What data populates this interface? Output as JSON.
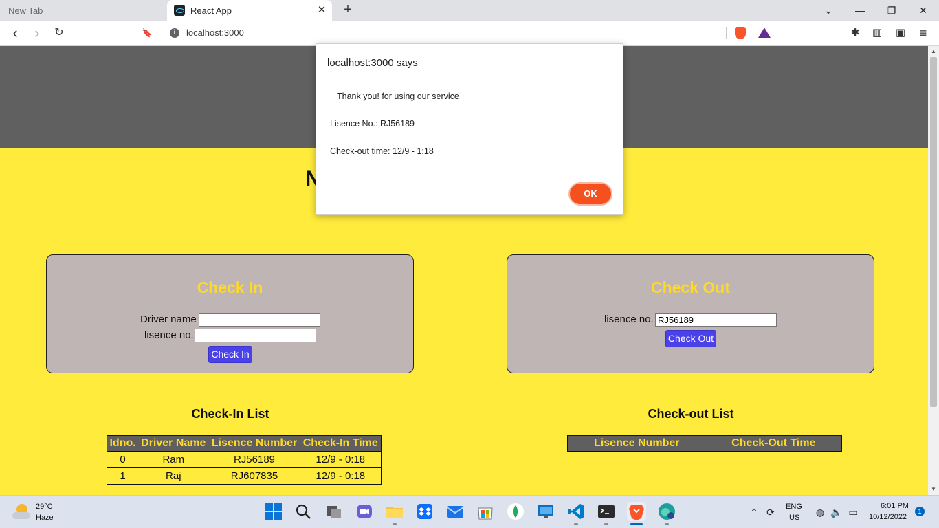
{
  "browser": {
    "tabs": [
      {
        "title": "New Tab",
        "active": false
      },
      {
        "title": "React App",
        "active": true
      }
    ],
    "url": "localhost:3000",
    "icons": {
      "back": "‹",
      "forward": "›",
      "reload": "↻",
      "bookmark": "🔖",
      "close": "✕",
      "new_tab": "+",
      "tab_search": "⌄",
      "minimize": "—",
      "restore": "❐",
      "close_window": "✕",
      "extensions": "✱",
      "sidebar": "▥",
      "wallet": "▣",
      "menu": "≡"
    }
  },
  "app": {
    "title_fragment": "N",
    "check_in": {
      "title": "Check In",
      "driver_name_label": "Driver name",
      "driver_name_value": "",
      "licence_label": "lisence no.",
      "licence_value": "",
      "button": "Check In"
    },
    "check_out": {
      "title": "Check Out",
      "licence_label": "lisence no.",
      "licence_value": "RJ56189",
      "button": "Check Out"
    },
    "check_in_list": {
      "title": "Check-In List",
      "columns": [
        "Idno.",
        "Driver Name",
        "Lisence Number",
        "Check-In Time"
      ],
      "rows": [
        [
          "0",
          "Ram",
          "RJ56189",
          "12/9 - 0:18"
        ],
        [
          "1",
          "Raj",
          "RJ607835",
          "12/9 - 0:18"
        ]
      ]
    },
    "check_out_list": {
      "title": "Check-out List",
      "columns": [
        "Lisence Number",
        "Check-Out Time"
      ]
    },
    "colors": {
      "page_bg": "#ffeb3b",
      "header_bg": "#606060",
      "card_bg": "#bfb5b5",
      "card_title": "#ffd92a",
      "button_bg": "#4a42e8",
      "dialog_ok": "#f4511e"
    }
  },
  "dialog": {
    "title": "localhost:3000 says",
    "lines": [
      "Thank you! for using our service",
      "Lisence No.: RJ56189",
      "Check-out time: 12/9 - 1:18"
    ],
    "ok": "OK"
  },
  "taskbar": {
    "weather_temp": "29°C",
    "weather_condition": "Haze",
    "language": "ENG",
    "region": "US",
    "time": "6:01 PM",
    "date": "10/12/2022",
    "notifications": "1",
    "apps": [
      "start",
      "search",
      "task-view",
      "teams-chat",
      "file-explorer",
      "dropbox",
      "mail",
      "store",
      "git-client",
      "remote-desktop",
      "vscode",
      "terminal",
      "brave-browser",
      "edge-dev"
    ]
  }
}
